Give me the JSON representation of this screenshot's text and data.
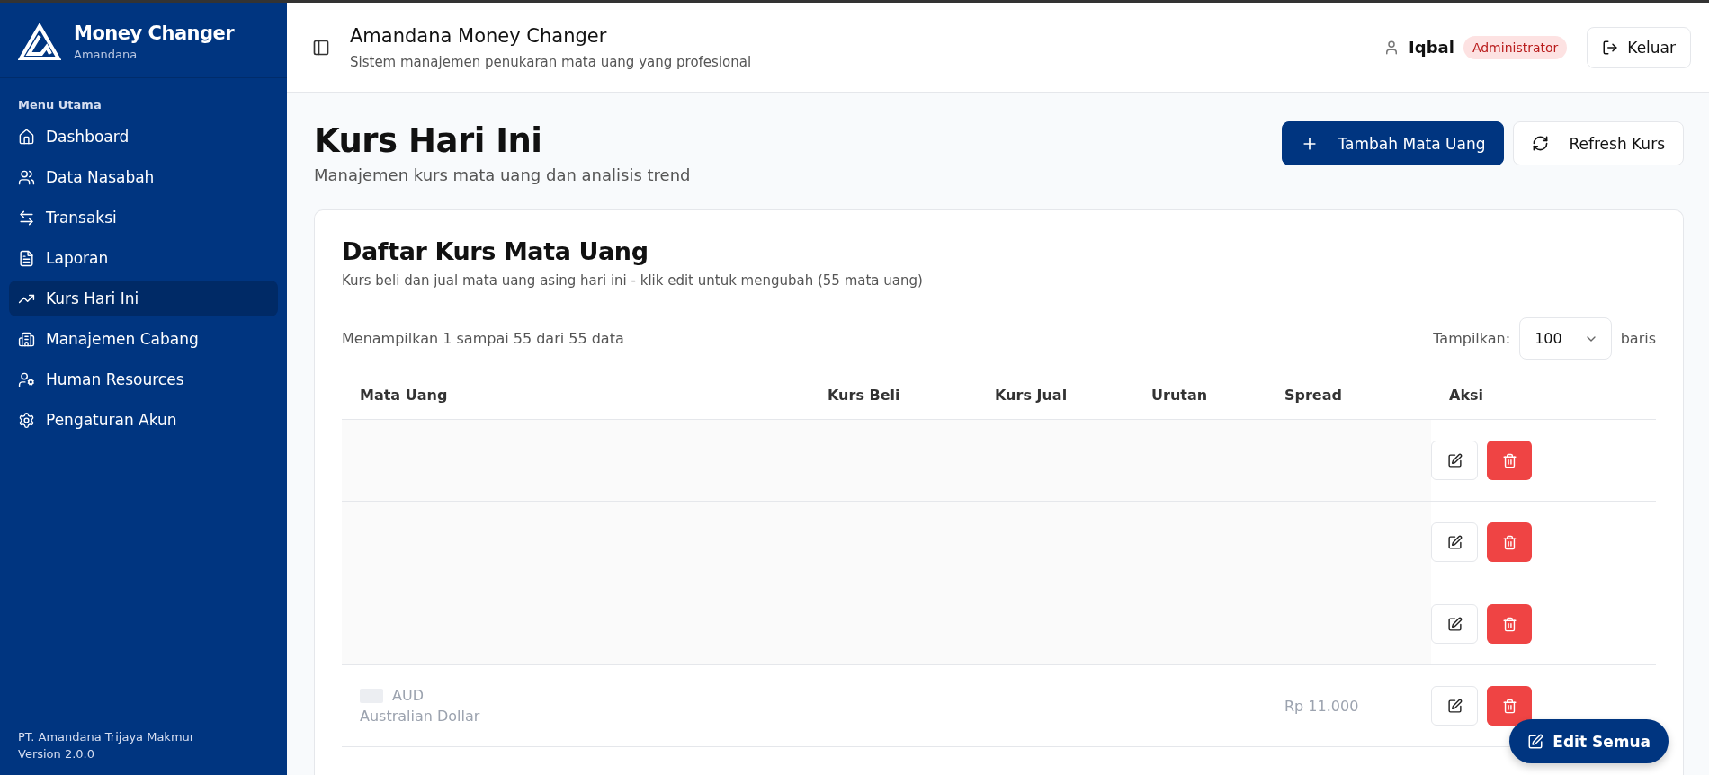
{
  "brand": {
    "title": "Money Changer",
    "subtitle": "Amandana"
  },
  "sidebar": {
    "section": "Menu Utama",
    "items": [
      {
        "label": "Dashboard",
        "selected": false
      },
      {
        "label": "Data Nasabah",
        "selected": false
      },
      {
        "label": "Transaksi",
        "selected": false
      },
      {
        "label": "Laporan",
        "selected": false
      },
      {
        "label": "Kurs Hari Ini",
        "selected": true
      },
      {
        "label": "Manajemen Cabang",
        "selected": false
      },
      {
        "label": "Human Resources",
        "selected": false
      },
      {
        "label": "Pengaturan Akun",
        "selected": false
      }
    ],
    "footer": [
      "PT. Amandana Trijaya Makmur",
      "Version 2.0.0"
    ]
  },
  "header": {
    "title": "Amandana Money Changer",
    "subtitle": "Sistem manajemen penukaran mata uang yang profesional",
    "user": "Iqbal",
    "role": "Administrator",
    "logout": "Keluar"
  },
  "page": {
    "title": "Kurs Hari Ini",
    "subtitle": "Manajemen kurs mata uang dan analisis trend",
    "buttons": [
      {
        "label": "Tambah Mata Uang",
        "kind": "primary"
      },
      {
        "label": "Refresh Kurs",
        "kind": "outline"
      }
    ]
  },
  "card": {
    "title": "Daftar Kurs Mata Uang",
    "subtitle": "Kurs beli dan jual mata uang asing hari ini - klik edit untuk mengubah (55 mata uang)",
    "summary": "Menampilkan 1 sampai 55 dari 55 data",
    "show_label": "Tampilkan:",
    "page_size": "100",
    "rows_label": "baris"
  },
  "table": {
    "columns": [
      "Mata Uang",
      "Kurs Beli",
      "Kurs Jual",
      "Urutan",
      "Spread",
      "Aksi"
    ],
    "rows": [
      {
        "obscured": true
      },
      {
        "obscured": true
      },
      {
        "obscured": true
      },
      {
        "obscured": false,
        "code": "AUD",
        "name": "Australian Dollar",
        "spread": "Rp 11.000"
      }
    ]
  },
  "fab": {
    "label": "Edit Semua"
  }
}
